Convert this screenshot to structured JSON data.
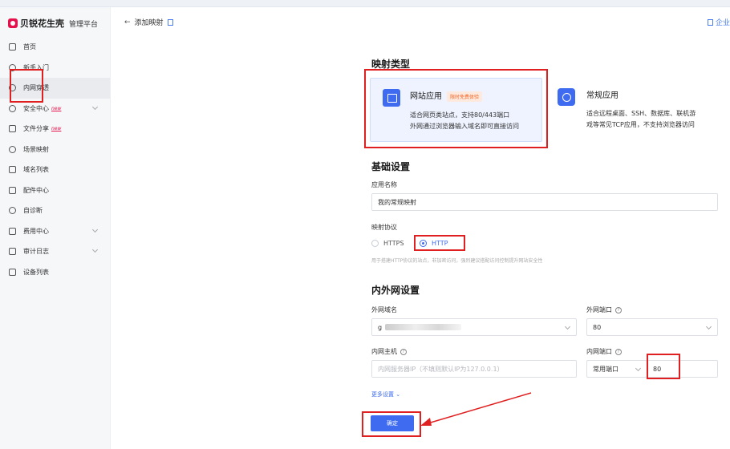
{
  "brand": {
    "name": "贝锐花生壳",
    "platform": "管理平台"
  },
  "sidebar": {
    "items": [
      {
        "label": "首页",
        "icon": "home-icon"
      },
      {
        "label": "新手入门",
        "icon": "lightbulb-icon"
      },
      {
        "label": "内网穿透",
        "icon": "tunnel-icon",
        "active": true
      },
      {
        "label": "安全中心",
        "icon": "shield-icon",
        "badge": "new"
      },
      {
        "label": "文件分享",
        "icon": "file-share-icon",
        "badge": "new"
      },
      {
        "label": "场景映射",
        "icon": "scene-icon"
      },
      {
        "label": "域名列表",
        "icon": "domain-icon"
      },
      {
        "label": "配件中心",
        "icon": "grid-icon"
      },
      {
        "label": "自诊断",
        "icon": "diagnose-icon"
      },
      {
        "label": "费用中心",
        "icon": "billing-icon"
      },
      {
        "label": "审计日志",
        "icon": "log-icon"
      },
      {
        "label": "设备列表",
        "icon": "device-icon"
      }
    ]
  },
  "header": {
    "back_label": "添加映射",
    "right_label": "企业"
  },
  "mapping_type": {
    "title": "映射类型",
    "cards": [
      {
        "title": "网站应用",
        "tag": "限时免费体验",
        "desc_line1": "适合网页类站点，支持80/443端口",
        "desc_line2": "外网通过浏览器输入域名即可直接访问"
      },
      {
        "title": "常规应用",
        "desc_line1": "适合远程桌面、SSH、数据库、联机游",
        "desc_line2": "戏等常见TCP应用，不支持浏览器访问"
      }
    ]
  },
  "basic": {
    "title": "基础设置",
    "app_name_label": "应用名称",
    "app_name_value": "我的常规映射",
    "protocol_label": "映射协议",
    "protocol_https": "HTTPS",
    "protocol_http": "HTTP",
    "protocol_hint": "用于搭建HTTP协议的站点，非加密访问，强烈建议搭配访问控制提升网站安全性"
  },
  "network": {
    "title": "内外网设置",
    "domain_label": "外网域名",
    "domain_value_prefix": "g",
    "ext_port_label": "外网端口",
    "ext_port_value": "80",
    "host_label": "内网主机",
    "host_placeholder": "内网服务器IP（不填则默认IP为127.0.0.1）",
    "int_port_label": "内网端口",
    "int_port_type": "常用端口",
    "int_port_value": "80"
  },
  "more_settings": "更多设置",
  "confirm_button": "确定",
  "colors": {
    "accent": "#3e6bf0",
    "brand": "#e5114a",
    "annotation": "#e02020"
  }
}
